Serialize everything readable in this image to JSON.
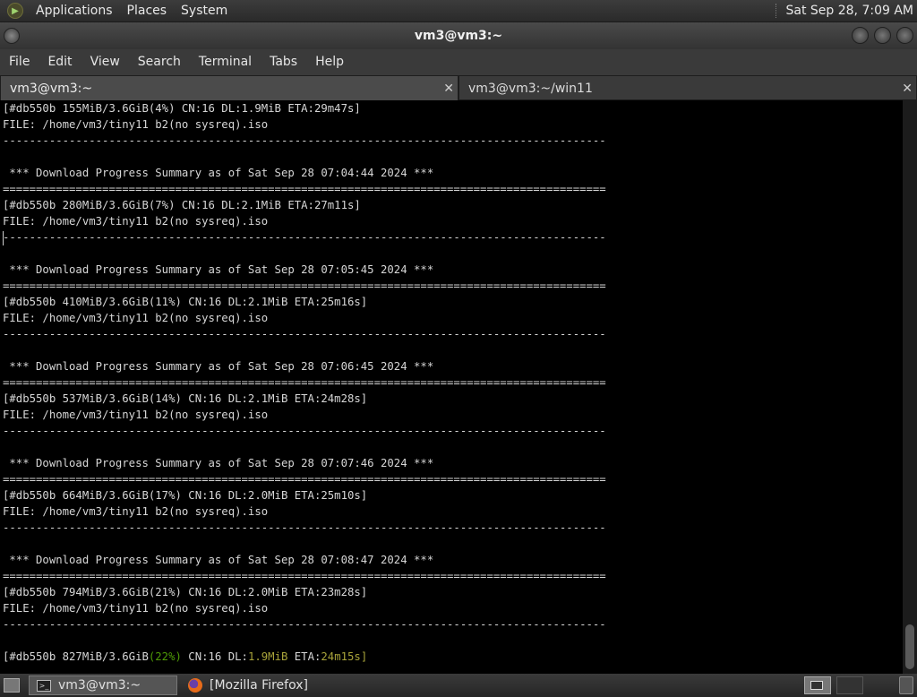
{
  "top_panel": {
    "menus": [
      "Applications",
      "Places",
      "System"
    ],
    "clock": "Sat Sep 28,  7:09 AM"
  },
  "window": {
    "title": "vm3@vm3:~"
  },
  "menubar": [
    "File",
    "Edit",
    "View",
    "Search",
    "Terminal",
    "Tabs",
    "Help"
  ],
  "tabs": [
    {
      "label": "vm3@vm3:~",
      "active": true
    },
    {
      "label": "vm3@vm3:~/win11",
      "active": false
    }
  ],
  "terminal": {
    "lines": [
      "[#db550b 155MiB/3.6GiB(4%) CN:16 DL:1.9MiB ETA:29m47s]",
      "FILE: /home/vm3/tiny11 b2(no sysreq).iso",
      "-------------------------------------------------------------------------------------------",
      "",
      " *** Download Progress Summary as of Sat Sep 28 07:04:44 2024 ***",
      "===========================================================================================",
      "[#db550b 280MiB/3.6GiB(7%) CN:16 DL:2.1MiB ETA:27m11s]",
      "FILE: /home/vm3/tiny11 b2(no sysreq).iso",
      "-------------------------------------------------------------------------------------------",
      "",
      " *** Download Progress Summary as of Sat Sep 28 07:05:45 2024 ***",
      "===========================================================================================",
      "[#db550b 410MiB/3.6GiB(11%) CN:16 DL:2.1MiB ETA:25m16s]",
      "FILE: /home/vm3/tiny11 b2(no sysreq).iso",
      "-------------------------------------------------------------------------------------------",
      "",
      " *** Download Progress Summary as of Sat Sep 28 07:06:45 2024 ***",
      "===========================================================================================",
      "[#db550b 537MiB/3.6GiB(14%) CN:16 DL:2.1MiB ETA:24m28s]",
      "FILE: /home/vm3/tiny11 b2(no sysreq).iso",
      "-------------------------------------------------------------------------------------------",
      "",
      " *** Download Progress Summary as of Sat Sep 28 07:07:46 2024 ***",
      "===========================================================================================",
      "[#db550b 664MiB/3.6GiB(17%) CN:16 DL:2.0MiB ETA:25m10s]",
      "FILE: /home/vm3/tiny11 b2(no sysreq).iso",
      "-------------------------------------------------------------------------------------------",
      "",
      " *** Download Progress Summary as of Sat Sep 28 07:08:47 2024 ***",
      "===========================================================================================",
      "[#db550b 794MiB/3.6GiB(21%) CN:16 DL:2.0MiB ETA:23m28s]",
      "FILE: /home/vm3/tiny11 b2(no sysreq).iso",
      "-------------------------------------------------------------------------------------------",
      ""
    ],
    "status_line": {
      "prefix": "[#db550b 827MiB/3.6GiB",
      "percent": "(22%)",
      "cn": " CN:16 DL:",
      "speed": "1.9MiB",
      "eta_label": " ETA:",
      "eta": "24m15s",
      "suffix": "]"
    },
    "colors": {
      "green": "#4e9a06",
      "yellow": "#a8a33a",
      "text": "#d6d6d6"
    }
  },
  "taskbar": {
    "tasks": [
      {
        "label": "vm3@vm3:~",
        "icon": "terminal-icon",
        "active": true
      },
      {
        "label": "[Mozilla Firefox]",
        "icon": "firefox-icon",
        "active": false
      }
    ]
  }
}
